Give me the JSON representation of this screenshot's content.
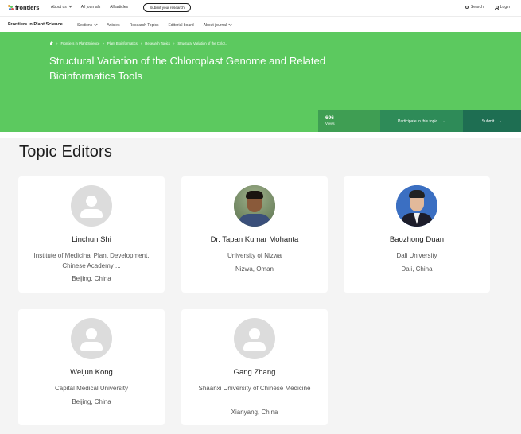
{
  "header": {
    "logo_text": "frontiers",
    "nav": [
      {
        "label": "About us",
        "has_dropdown": true
      },
      {
        "label": "All journals",
        "has_dropdown": false
      },
      {
        "label": "All articles",
        "has_dropdown": false
      }
    ],
    "submit_label": "Submit your research",
    "search_label": "Search",
    "login_label": "Login"
  },
  "journal_bar": {
    "name": "Frontiers in Plant Science",
    "nav": [
      {
        "label": "Sections",
        "has_dropdown": true
      },
      {
        "label": "Articles",
        "has_dropdown": false
      },
      {
        "label": "Research Topics",
        "has_dropdown": false
      },
      {
        "label": "Editorial board",
        "has_dropdown": false
      },
      {
        "label": "About journal",
        "has_dropdown": true
      }
    ]
  },
  "hero": {
    "breadcrumb": [
      "Frontiers in Plant Science",
      "Plant Bioinformatics",
      "Research Topics",
      "Structural Variation of the Chlor..."
    ],
    "title": "Structural Variation of the Chloroplast Genome and Related Bioinformatics Tools",
    "views_count": "696",
    "views_label": "Views",
    "participate_label": "Participate in this topic",
    "submit_label": "Submit"
  },
  "section": {
    "title": "Topic Editors"
  },
  "editors": [
    {
      "name": "Linchun Shi",
      "institution": "Institute of Medicinal Plant Development, Chinese Academy ...",
      "location": "Beijing, China",
      "avatar": "placeholder-avatar"
    },
    {
      "name": "Dr. Tapan Kumar Mohanta",
      "institution": "University of Nizwa",
      "location": "Nizwa, Oman",
      "avatar": "photo"
    },
    {
      "name": "Baozhong Duan",
      "institution": "Dali University",
      "location": "Dali, China",
      "avatar": "photo"
    },
    {
      "name": "Weijun Kong",
      "institution": "Capital Medical University",
      "location": "Beijing, China",
      "avatar": "placeholder-avatar"
    },
    {
      "name": "Gang Zhang",
      "institution": "Shaanxi University of Chinese Medicine",
      "location": "Xianyang, China",
      "avatar": "placeholder-avatar"
    }
  ],
  "colors": {
    "hero_green": "#5cc95f",
    "views_green": "#3f9e53",
    "participate_green": "#2e8b58",
    "submit_green": "#1e6e52",
    "page_bg": "#f4f4f4"
  }
}
